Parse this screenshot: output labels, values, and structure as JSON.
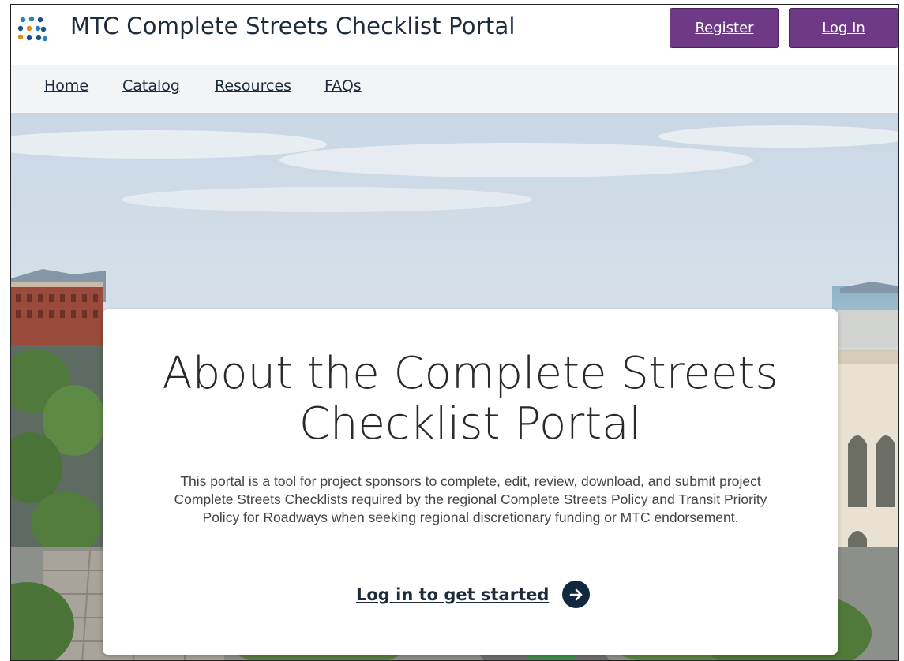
{
  "header": {
    "title": "MTC Complete Streets Checklist Portal",
    "logo_icon": "dots-logo-icon",
    "register_label": "Register",
    "login_label": "Log In",
    "brand_color": "#6e3a86"
  },
  "nav": {
    "items": [
      {
        "label": "Home"
      },
      {
        "label": "Catalog"
      },
      {
        "label": "Resources"
      },
      {
        "label": "FAQs"
      }
    ]
  },
  "hero": {
    "card": {
      "title_line1": "About the Complete Streets",
      "title_line2": "Checklist Portal",
      "description": "This portal is a tool for project sponsors to complete, edit, review, download, and submit project Complete Streets Checklists required by the regional Complete Streets Policy and Transit Priority Policy for Roadways when seeking regional discretionary funding or MTC endorsement.",
      "cta_label": "Log in to get started",
      "cta_icon": "arrow-right-circle-icon"
    }
  }
}
